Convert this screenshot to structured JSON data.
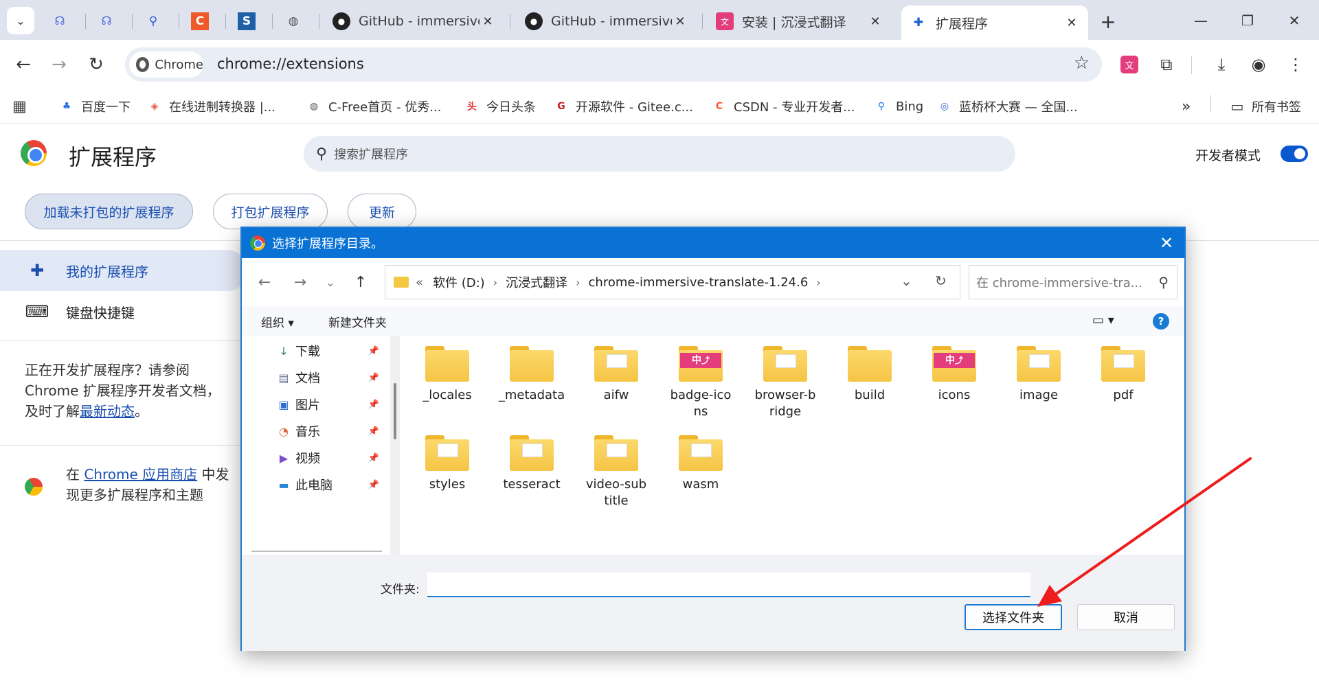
{
  "browser": {
    "tabs": [
      {
        "title": "",
        "icon": "weibo-icon"
      },
      {
        "title": "",
        "icon": "weibo-icon"
      },
      {
        "title": "",
        "icon": "search-icon"
      },
      {
        "title": "",
        "icon": "c-logo-icon"
      },
      {
        "title": "",
        "icon": "s-logo-icon"
      },
      {
        "title": "",
        "icon": "globe-icon"
      },
      {
        "title": "GitHub - immersive-",
        "icon": "github-icon"
      },
      {
        "title": "GitHub - immersive-",
        "icon": "github-icon"
      },
      {
        "title": "安装 | 沉浸式翻译",
        "icon": "translate-icon"
      },
      {
        "title": "扩展程序",
        "icon": "puzzle-icon",
        "active": true
      }
    ],
    "omnibox": {
      "chip_label": "Chrome",
      "url": "chrome://extensions"
    },
    "bookmarks": [
      {
        "label": "百度一下",
        "icon": "paw-icon",
        "color": "#2d6fe0"
      },
      {
        "label": "在线进制转换器 |...",
        "icon": "cube-icon",
        "color": "#e45b4a"
      },
      {
        "label": "C-Free首页 - 优秀...",
        "icon": "globe-icon",
        "color": "#555555"
      },
      {
        "label": "今日头条",
        "icon": "toutiao-icon",
        "color": "#e8333a"
      },
      {
        "label": "开源软件 - Gitee.c...",
        "icon": "gitee-icon",
        "color": "#c71d23"
      },
      {
        "label": "CSDN - 专业开发者...",
        "icon": "csdn-icon",
        "color": "#fc5531"
      },
      {
        "label": "Bing",
        "icon": "search-icon",
        "color": "#1a73e8"
      },
      {
        "label": "蓝桥杯大赛 — 全国...",
        "icon": "lanqiao-icon",
        "color": "#3d6cd6"
      }
    ],
    "overflow_label": "»",
    "all_bookmarks_label": "所有书签"
  },
  "page": {
    "title": "扩展程序",
    "search_placeholder": "搜索扩展程序",
    "dev_mode_label": "开发者模式",
    "dev_mode_on": true,
    "actions": {
      "load_unpacked": "加载未打包的扩展程序",
      "pack": "打包扩展程序",
      "update": "更新"
    },
    "sidebar": {
      "my_extensions": "我的扩展程序",
      "shortcuts": "键盘快捷键",
      "dev_text_1": "正在开发扩展程序？请参阅",
      "dev_text_2": "Chrome 扩展程序开发者文档，",
      "dev_text_3": "及时了解",
      "dev_link": "最新动态",
      "dev_text_end": "。",
      "store_prefix": "在 ",
      "store_link": "Chrome 应用商店",
      "store_suffix": " 中发",
      "store_text_2": "现更多扩展程序和主题"
    }
  },
  "dialog": {
    "title": "选择扩展程序目录。",
    "path": {
      "prefix": "«",
      "segments": [
        "软件 (D:)",
        "沉浸式翻译",
        "chrome-immersive-translate-1.24.6"
      ]
    },
    "search_placeholder": "在 chrome-immersive-tra...",
    "organize_label": "组织 ▾",
    "new_folder_label": "新建文件夹",
    "nav_items": [
      {
        "label": "下载",
        "icon": "download-icon"
      },
      {
        "label": "文档",
        "icon": "document-icon"
      },
      {
        "label": "图片",
        "icon": "picture-icon"
      },
      {
        "label": "音乐",
        "icon": "music-icon"
      },
      {
        "label": "视频",
        "icon": "video-icon"
      },
      {
        "label": "此电脑",
        "icon": "computer-icon"
      }
    ],
    "folders": [
      {
        "name": "_locales",
        "style": "plain"
      },
      {
        "name": "_metadata",
        "style": "plain"
      },
      {
        "name": "aifw",
        "style": "paper"
      },
      {
        "name": "badge-icons",
        "name_lines": [
          "badge-ico",
          "ns"
        ],
        "style": "badge"
      },
      {
        "name": "browser-bridge",
        "name_lines": [
          "browser-b",
          "ridge"
        ],
        "style": "paper"
      },
      {
        "name": "build",
        "style": "plain"
      },
      {
        "name": "icons",
        "style": "badge"
      },
      {
        "name": "image",
        "style": "paper"
      },
      {
        "name": "pdf",
        "style": "paper"
      },
      {
        "name": "styles",
        "style": "paper"
      },
      {
        "name": "tesseract",
        "style": "paper"
      },
      {
        "name": "video-subtitle",
        "name_lines": [
          "video-sub",
          "title"
        ],
        "style": "paper"
      },
      {
        "name": "wasm",
        "style": "paper"
      }
    ],
    "folder_label": "文件夹:",
    "folder_value": "",
    "select_button": "选择文件夹",
    "cancel_button": "取消"
  }
}
